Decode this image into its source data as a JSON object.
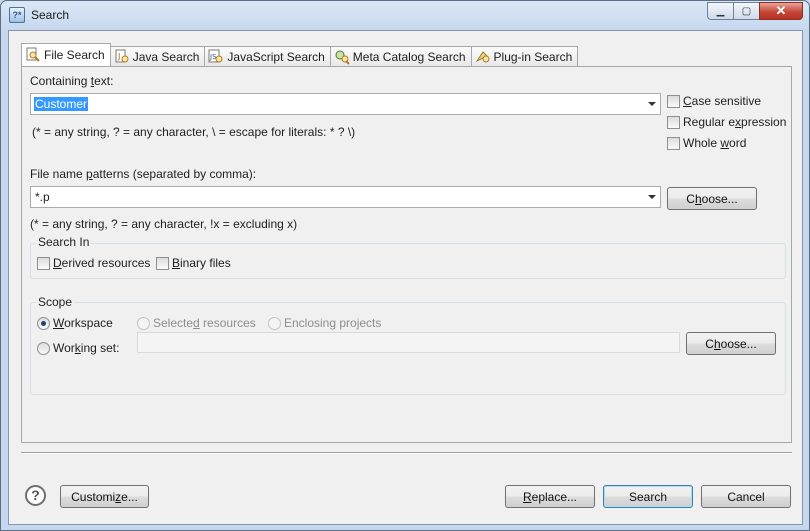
{
  "window": {
    "title": "Search"
  },
  "tabs": [
    {
      "label": "File Search",
      "icon": "file-search-icon"
    },
    {
      "label": "Java Search",
      "icon": "java-search-icon"
    },
    {
      "label": "JavaScript Search",
      "icon": "javascript-search-icon"
    },
    {
      "label": "Meta Catalog Search",
      "icon": "meta-catalog-icon"
    },
    {
      "label": "Plug-in Search",
      "icon": "plugin-search-icon"
    }
  ],
  "containing_text": {
    "label_pre": "Containing ",
    "label_mn": "t",
    "label_post": "ext:",
    "value": "Customer",
    "hint": "(* = any string, ? = any character, \\ = escape for literals: * ? \\)"
  },
  "options": {
    "case_pre": "",
    "case_mn": "C",
    "case_post": "ase sensitive",
    "regex_pre": "Regular e",
    "regex_mn": "x",
    "regex_post": "pression",
    "whole_pre": "Whole ",
    "whole_mn": "w",
    "whole_post": "ord"
  },
  "file_patterns": {
    "label_pre": "File name ",
    "label_mn": "p",
    "label_post": "atterns (separated by comma):",
    "value": "*.p",
    "hint": "(* = any string, ? = any character, !x = excluding x)",
    "choose_pre": "C",
    "choose_mn": "h",
    "choose_post": "oose..."
  },
  "search_in": {
    "title": "Search In",
    "derived_pre": "",
    "derived_mn": "D",
    "derived_post": "erived resources",
    "binary_pre": "",
    "binary_mn": "B",
    "binary_post": "inary files"
  },
  "scope": {
    "title": "Scope",
    "workspace_pre": "",
    "workspace_mn": "W",
    "workspace_post": "orkspace",
    "selected_pre": "Selecte",
    "selected_mn": "d",
    "selected_post": " resources",
    "enclosing": "Enclosing projects",
    "working_pre": "Wor",
    "working_mn": "k",
    "working_post": "ing set:",
    "choose_pre": "C",
    "choose_mn": "h",
    "choose_post": "oose..."
  },
  "footer": {
    "customize_pre": "Customi",
    "customize_mn": "z",
    "customize_post": "e...",
    "replace_pre": "",
    "replace_mn": "R",
    "replace_post": "eplace...",
    "search": "Search",
    "cancel": "Cancel"
  }
}
